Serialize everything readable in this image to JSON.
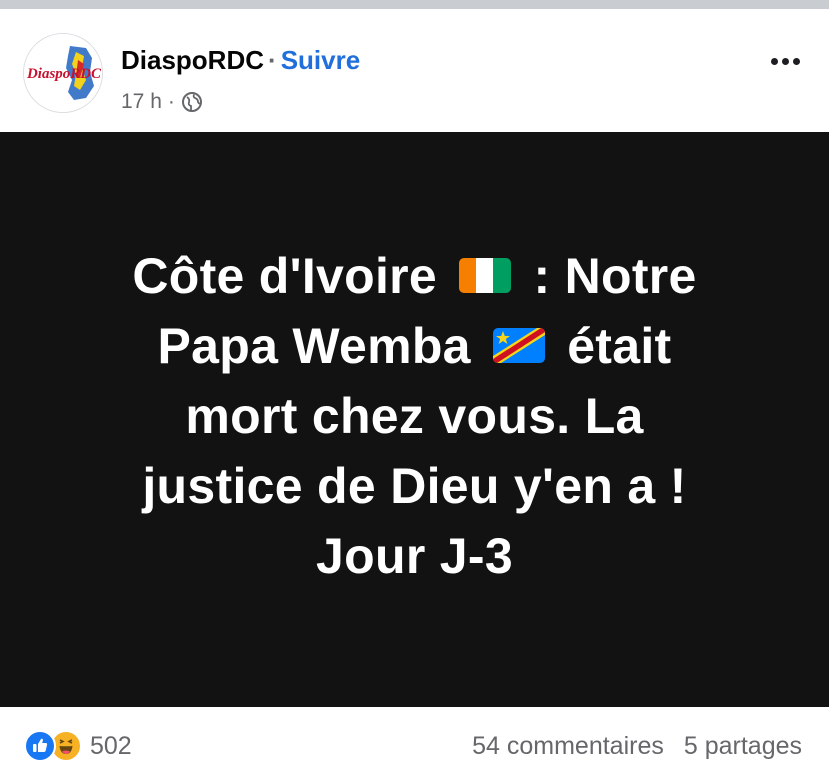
{
  "post": {
    "author": "DiaspoRDC",
    "separator": "·",
    "follow_label": "Suivre",
    "time": "17 h",
    "meta_separator": "·",
    "privacy_icon": "globe-icon",
    "more_icon": "more-options-icon",
    "avatar_logo_text": "DiaspoRDC",
    "content_lines": [
      {
        "before": "Côte d'Ivoire",
        "flag": "cote-divoire-flag",
        "after": ": Notre"
      },
      {
        "before": "Papa Wemba",
        "flag": "drc-flag",
        "after": "était"
      },
      {
        "text": "mort chez vous. La"
      },
      {
        "text": "justice de Dieu y'en a !"
      },
      {
        "text": "Jour J-3"
      }
    ],
    "reactions": {
      "icons": [
        "like-icon",
        "haha-icon"
      ],
      "count": "502"
    },
    "comments": "54 commentaires",
    "shares": "5 partages"
  },
  "colors": {
    "media_background": "#121212",
    "follow_link": "#216fdb",
    "secondary_text": "#65676b",
    "like_blue": "#1877f2",
    "haha_yellow": "#f7b125"
  }
}
